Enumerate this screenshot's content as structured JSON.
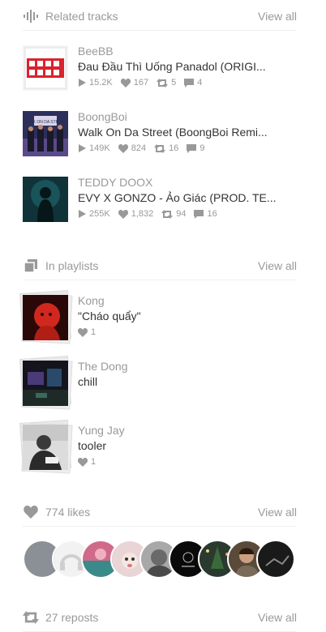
{
  "related": {
    "heading": "Related tracks",
    "view_all": "View all",
    "tracks": [
      {
        "user": "BeeBB",
        "title": "Đau Đầu Thì Uống Panadol (ORIGI...",
        "plays": "15.2K",
        "likes": "167",
        "reposts": "5",
        "comments": "4"
      },
      {
        "user": "BoongBoi",
        "title": "Walk On Da Street (BoongBoi Remi...",
        "plays": "149K",
        "likes": "824",
        "reposts": "16",
        "comments": "9"
      },
      {
        "user": "TEDDY DOOX",
        "title": "EVY X GONZO - Ảo Giác (PROD. TE...",
        "plays": "255K",
        "likes": "1,832",
        "reposts": "94",
        "comments": "16"
      }
    ]
  },
  "playlists": {
    "heading": "In playlists",
    "view_all": "View all",
    "items": [
      {
        "user": "Kong",
        "title": "\"Cháo quẩy\"",
        "likes": "1"
      },
      {
        "user": "The Dong",
        "title": "chill",
        "likes": ""
      },
      {
        "user": "Yung Jay",
        "title": "tooler",
        "likes": "1"
      }
    ]
  },
  "likes": {
    "heading": "774 likes",
    "view_all": "View all"
  },
  "reposts": {
    "heading": "27 reposts",
    "view_all": "View all"
  },
  "art_text": {
    "walk": "WALK ON DA STREET"
  }
}
